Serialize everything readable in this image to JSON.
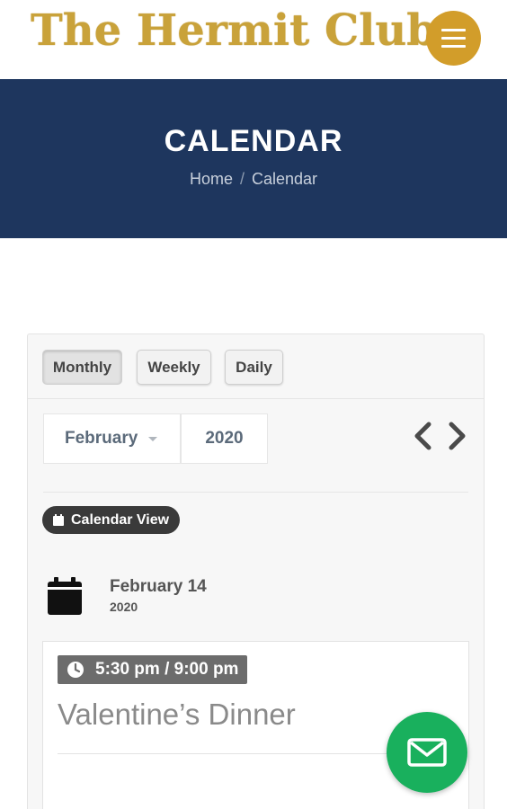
{
  "header": {
    "logo_text": "The Hermit Club",
    "menu_icon": "hamburger-menu-icon",
    "brand_gold": "#d29d2a"
  },
  "hero": {
    "title": "CALENDAR",
    "breadcrumb": {
      "home": "Home",
      "separator": "/",
      "current": "Calendar"
    },
    "background": "#1e365e"
  },
  "calendar": {
    "views": [
      {
        "label": "Monthly",
        "active": true
      },
      {
        "label": "Weekly",
        "active": false
      },
      {
        "label": "Daily",
        "active": false
      }
    ],
    "month_select": {
      "value": "February"
    },
    "year_select": {
      "value": "2020"
    },
    "nav": {
      "prev_icon": "chevron-left-icon",
      "next_icon": "chevron-right-icon"
    },
    "view_badge": {
      "label": "Calendar View",
      "icon": "calendar-icon"
    },
    "date_group": {
      "date": "February 14",
      "year": "2020",
      "icon": "calendar-icon"
    },
    "events": [
      {
        "time": "5:30 pm / 9:00 pm",
        "title": "Valentine’s Dinner",
        "time_icon": "clock-icon"
      }
    ]
  },
  "fab": {
    "icon": "envelope-icon",
    "color": "#19b05d"
  }
}
